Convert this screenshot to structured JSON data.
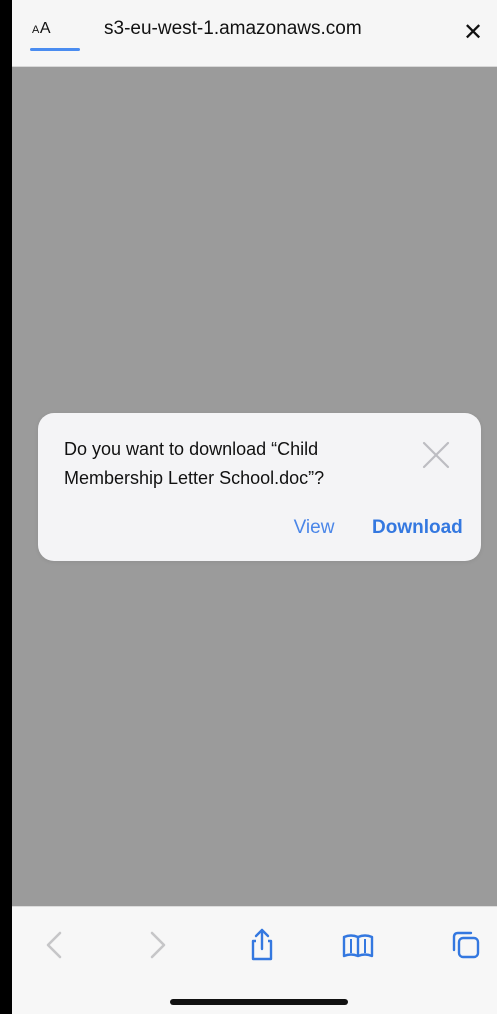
{
  "address_bar": {
    "text_size_label_small": "A",
    "text_size_label_large": "A",
    "url": "s3-eu-west-1.amazonaws.com",
    "close_label": "✕"
  },
  "dialog": {
    "message": "Do you want to download “Child Membership Letter School.doc”?",
    "view_label": "View",
    "download_label": "Download"
  },
  "toolbar": {
    "icons": [
      "chevron-left-icon",
      "chevron-right-icon",
      "share-icon",
      "book-icon",
      "tabs-icon"
    ]
  },
  "colors": {
    "accent": "#3478e0",
    "overlay": "#9b9b9b"
  }
}
